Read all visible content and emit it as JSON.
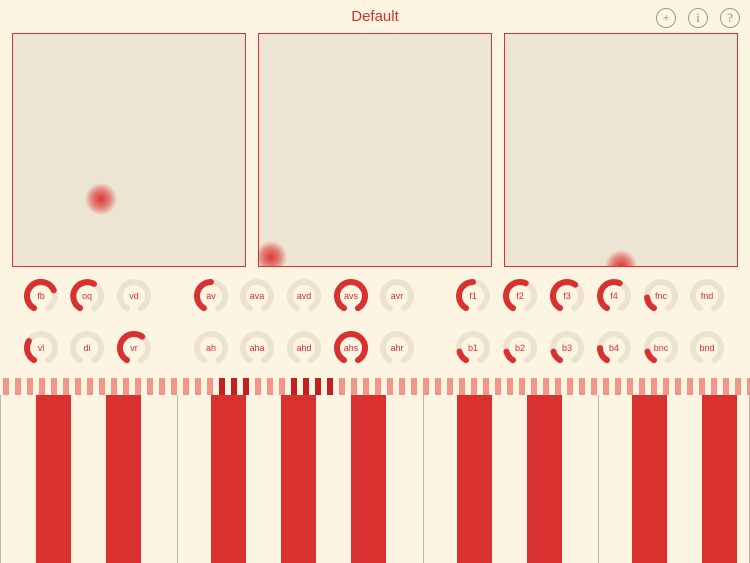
{
  "header": {
    "title": "Default"
  },
  "icons": {
    "add": "+",
    "info": "i",
    "help": "?"
  },
  "colors": {
    "accent": "#d93030",
    "track": "#ece3cf",
    "pad": "#ede5d3",
    "background": "#fdf5e2"
  },
  "pads": [
    {
      "dot": [
        0.38,
        0.71
      ]
    },
    {
      "dot": [
        0.05,
        0.96
      ]
    },
    {
      "dot": [
        0.5,
        1.0
      ]
    }
  ],
  "knobs": {
    "row1": [
      {
        "label": "fb",
        "value": 0.72
      },
      {
        "label": "oq",
        "value": 0.6
      },
      {
        "label": "vd",
        "value": 0.0
      },
      {
        "label": "av",
        "value": 0.5
      },
      {
        "label": "ava",
        "value": 0.0
      },
      {
        "label": "avd",
        "value": 0.0
      },
      {
        "label": "avs",
        "value": 1.0
      },
      {
        "label": "avr",
        "value": 0.0
      },
      {
        "label": "f1",
        "value": 0.5
      },
      {
        "label": "f2",
        "value": 0.58
      },
      {
        "label": "f3",
        "value": 0.62
      },
      {
        "label": "f4",
        "value": 0.58
      },
      {
        "label": "fnc",
        "value": 0.18
      },
      {
        "label": "fnd",
        "value": 0.0
      }
    ],
    "row2": [
      {
        "label": "vl",
        "value": 0.3
      },
      {
        "label": "di",
        "value": 0.0
      },
      {
        "label": "vr",
        "value": 0.62
      },
      {
        "label": "ah",
        "value": 0.0
      },
      {
        "label": "aha",
        "value": 0.0
      },
      {
        "label": "ahd",
        "value": 0.0
      },
      {
        "label": "ahs",
        "value": 1.0
      },
      {
        "label": "ahr",
        "value": 0.0
      },
      {
        "label": "b1",
        "value": 0.15
      },
      {
        "label": "b2",
        "value": 0.15
      },
      {
        "label": "b3",
        "value": 0.15
      },
      {
        "label": "b4",
        "value": 0.2
      },
      {
        "label": "bnc",
        "value": 0.15
      },
      {
        "label": "bnd",
        "value": 0.0
      }
    ]
  }
}
